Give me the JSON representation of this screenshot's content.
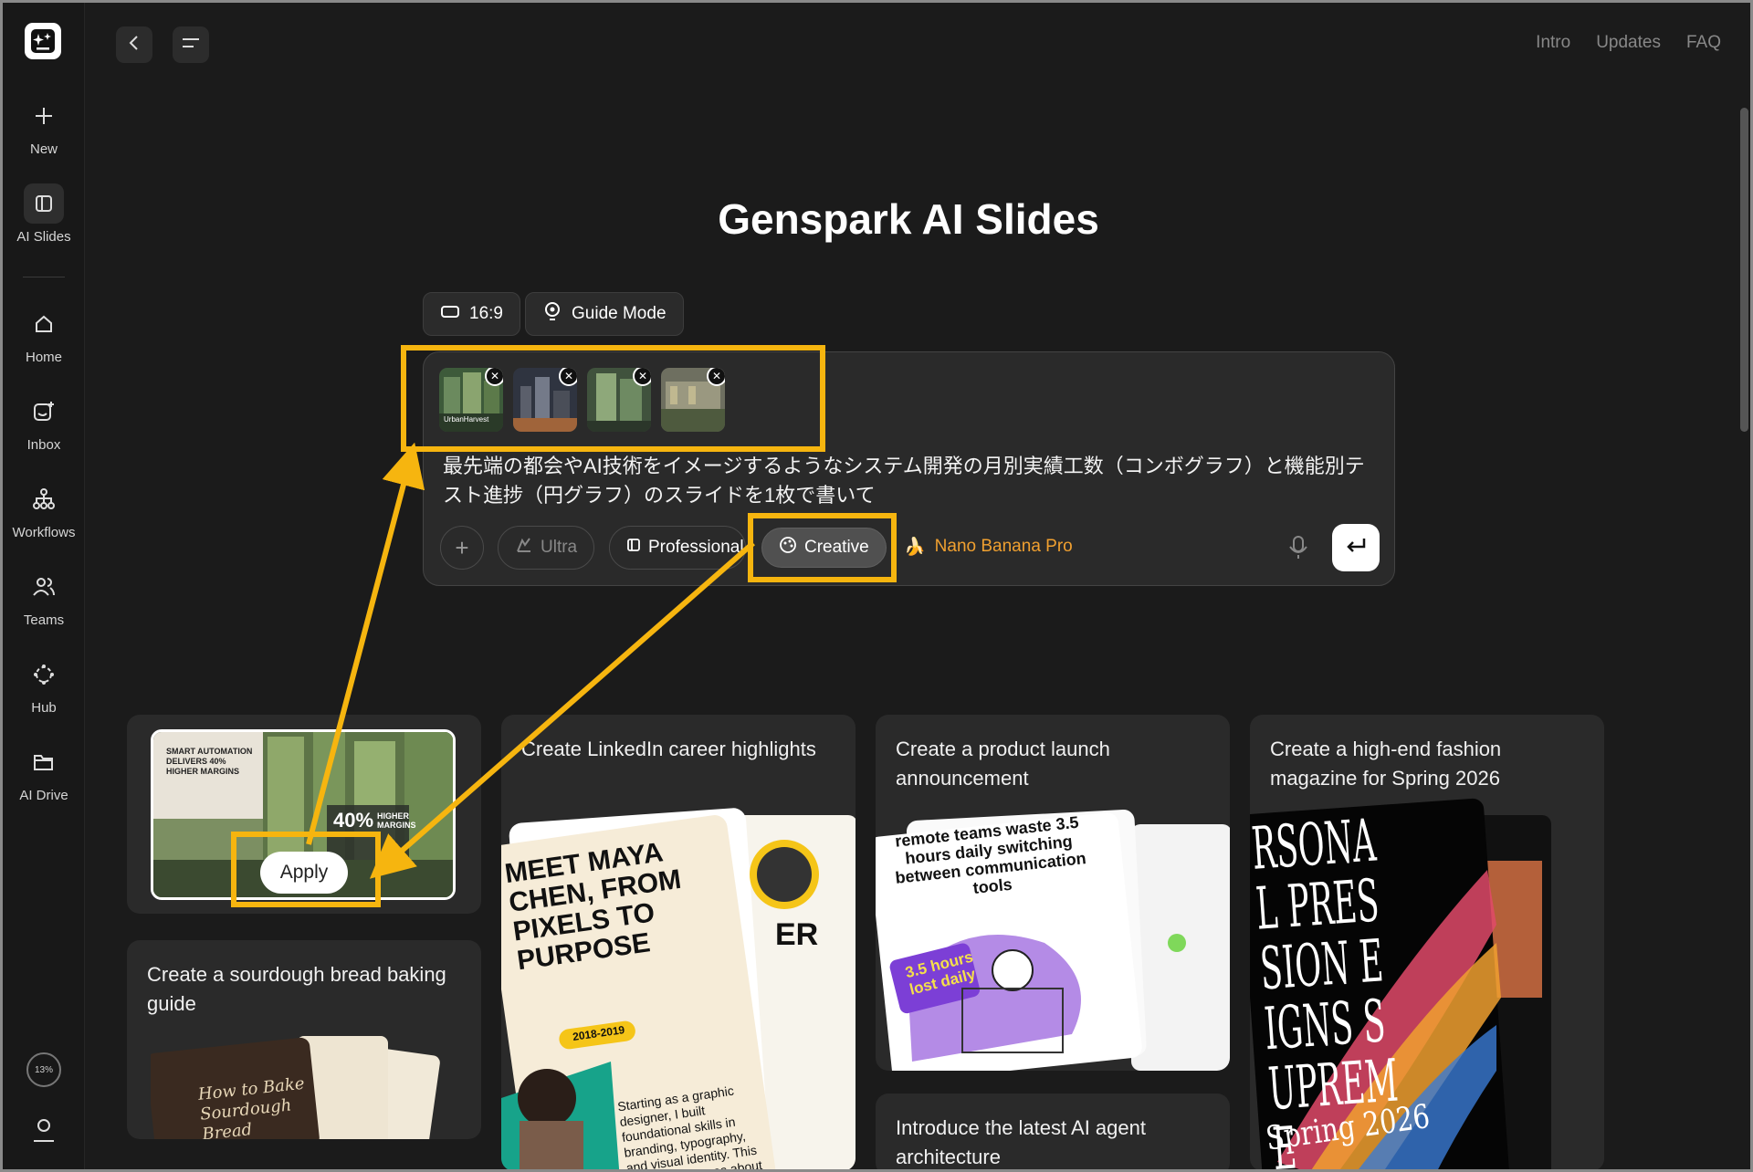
{
  "app": {
    "title": "Genspark AI Slides"
  },
  "sidebar": {
    "items": [
      {
        "label": "New",
        "icon": "plus-icon"
      },
      {
        "label": "AI Slides",
        "icon": "slides-icon"
      },
      {
        "label": "Home",
        "icon": "home-icon"
      },
      {
        "label": "Inbox",
        "icon": "inbox-icon"
      },
      {
        "label": "Workflows",
        "icon": "workflow-icon"
      },
      {
        "label": "Teams",
        "icon": "teams-icon"
      },
      {
        "label": "Hub",
        "icon": "hub-icon"
      },
      {
        "label": "AI Drive",
        "icon": "folder-icon"
      }
    ],
    "progress": "13%"
  },
  "topnav": {
    "links": [
      "Intro",
      "Updates",
      "FAQ"
    ]
  },
  "options": {
    "ratio": "16:9",
    "guide_mode": "Guide Mode"
  },
  "prompt": {
    "attachments": [
      {
        "name": "UrbanHarvest"
      },
      {
        "name": "image-2"
      },
      {
        "name": "image-3"
      },
      {
        "name": "image-4"
      }
    ],
    "text": "最先端の都会やAI技術をイメージするようなシステム開発の月別実績工数（コンボグラフ）と機能別テスト進捗（円グラフ）のスライドを1枚で書いて",
    "tools": {
      "ultra": "Ultra",
      "professional": "Professional",
      "creative": "Creative"
    },
    "model": "Nano Banana Pro"
  },
  "cards": {
    "apply_label": "Apply",
    "template_texts": {
      "line1": "SMART AUTOMATION",
      "line2": "DELIVERS 40%",
      "line3": "HIGHER MARGINS",
      "badge_num": "40%",
      "badge_txt1": "HIGHER",
      "badge_txt2": "MARGINS"
    },
    "sourdough": {
      "title": "Create a sourdough bread baking guide",
      "art": "How to Bake Sourdough Bread"
    },
    "linkedin": {
      "title": "Create LinkedIn career highlights",
      "art_title": "MEET MAYA CHEN, FROM PIXELS TO PURPOSE",
      "years": "2018-2019",
      "art_body": "Starting as a graphic designer, I built foundational skills in branding, typography, and visual identity. This early journey was about understanding the power of visual",
      "side": "ER"
    },
    "product": {
      "title": "Create a product launch announcement",
      "art": "remote teams waste 3.5 hours daily switching between communication tools",
      "badge": "3.5 hours lost daily"
    },
    "agent": {
      "title": "Introduce the latest AI agent architecture"
    },
    "fashion": {
      "title": "Create a high-end fashion magazine for Spring 2026",
      "art": "RSONAL PRESSION EIGNS SUPREME",
      "season": "Spring 2026"
    }
  },
  "colors": {
    "highlight": "#f6b50f",
    "background": "#1b1b1b",
    "model": "#f0a030"
  }
}
